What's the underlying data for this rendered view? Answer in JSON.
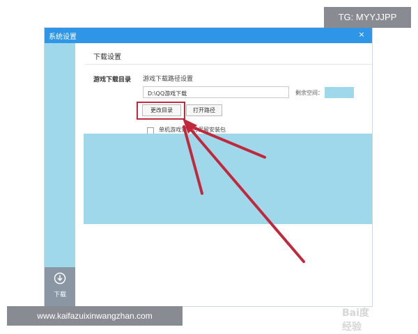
{
  "window": {
    "title": "系统设置",
    "close_glyph": "×"
  },
  "sidebar": {
    "download_label": "下载",
    "download_icon": "download-icon"
  },
  "content": {
    "title": "下载设置",
    "section_label": "游戏下载目录",
    "path_setting_label": "游戏下载路径设置",
    "path_value": "D:\\QQ游戏下载",
    "remaining_label": "剩余空间：",
    "change_dir_label": "更改目录",
    "open_path_label": "打开路径",
    "checkbox_label": "单机游戏安装后保留安装包"
  },
  "overlays": {
    "tag_label": "TG: MYYJJPP",
    "url_label": "www.kaifazuixinwangzhan.com",
    "watermark_text": "Bai度经验"
  },
  "colors": {
    "titlebar": "#2f95e6",
    "highlight": "#c0293b",
    "arrow": "#c0293b",
    "panel_fill": "#9fd8ea",
    "overlay_bg": "#888c92"
  }
}
